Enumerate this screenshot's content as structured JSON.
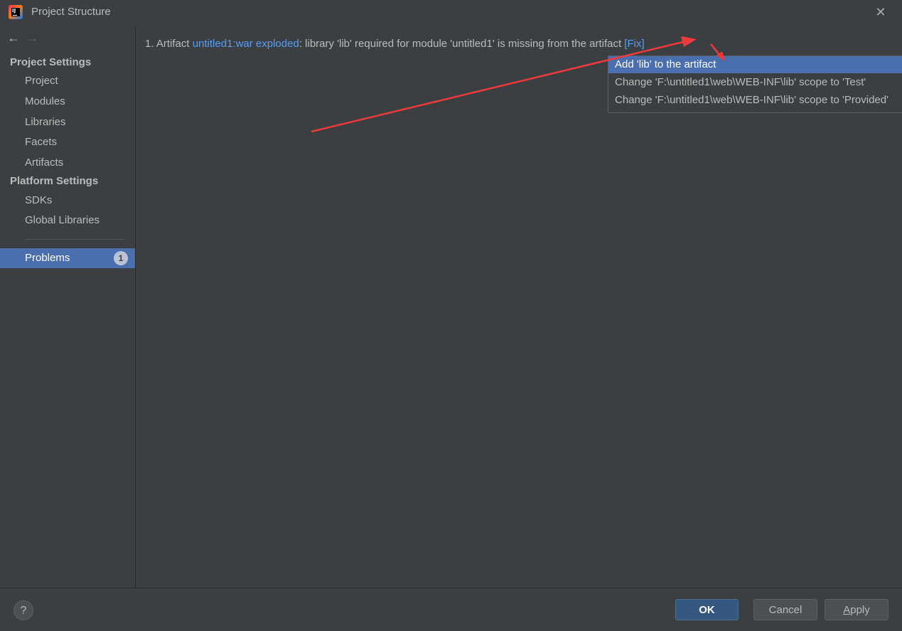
{
  "window": {
    "title": "Project Structure",
    "close_glyph": "✕"
  },
  "sidebar": {
    "back_glyph": "←",
    "forward_glyph": "→",
    "project_settings_header": "Project Settings",
    "project_items": [
      "Project",
      "Modules",
      "Libraries",
      "Facets",
      "Artifacts"
    ],
    "platform_settings_header": "Platform Settings",
    "platform_items": [
      "SDKs",
      "Global Libraries"
    ],
    "problems": {
      "label": "Problems",
      "count": "1"
    }
  },
  "main": {
    "problem": {
      "prefix": "1. Artifact ",
      "artifact_link": "untitled1:war exploded",
      "message": ": library 'lib' required for module 'untitled1' is missing from the artifact ",
      "fix_link": "[Fix]"
    },
    "fix_popup": {
      "items": [
        "Add 'lib' to the artifact",
        "Change 'F:\\untitled1\\web\\WEB-INF\\lib' scope to 'Test'",
        "Change 'F:\\untitled1\\web\\WEB-INF\\lib' scope to 'Provided'"
      ],
      "selected_index": 0
    }
  },
  "footer": {
    "help_glyph": "?",
    "ok_label": "OK",
    "cancel_label": "Cancel",
    "apply_mnemonic": "A",
    "apply_rest": "pply"
  },
  "colors": {
    "accent_selection": "#4b6eaf",
    "link": "#589df6",
    "annotation_arrow": "#ee3a3a"
  }
}
